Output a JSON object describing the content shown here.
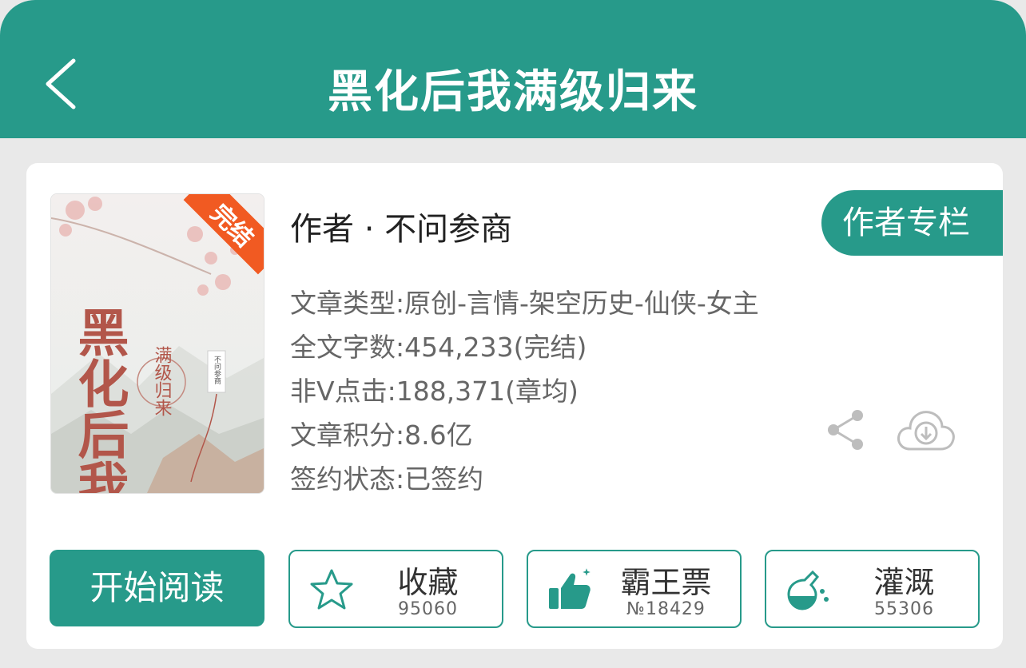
{
  "header": {
    "title": "黑化后我满级归来",
    "back_icon": "chevron-left-icon"
  },
  "book": {
    "cover": {
      "badge": "完结",
      "title_art": "黑化后我",
      "subtitle_art": "满级归来",
      "author_tag": "不问参商"
    },
    "author_line": "作者 · 不问参商",
    "author_column_label": "作者专栏",
    "meta": {
      "genre": "文章类型:原创-言情-架空历史-仙侠-女主",
      "word_count": "全文字数:454,233(完结)",
      "clicks": "非Ⅴ点击:188,371(章均)",
      "score": "文章积分:8.6亿",
      "contract": "签约状态:已签约"
    }
  },
  "actions": {
    "read_label": "开始阅读",
    "favorite": {
      "label": "收藏",
      "count": "95060",
      "icon": "star-icon"
    },
    "vote": {
      "label": "霸王票",
      "count": "№18429",
      "icon": "thumbs-up-icon"
    },
    "nutrient": {
      "label": "灌溉",
      "count": "55306",
      "icon": "flask-icon"
    }
  },
  "colors": {
    "primary": "#279a8a",
    "background": "#e9e9e9",
    "badge": "#f15a22"
  }
}
